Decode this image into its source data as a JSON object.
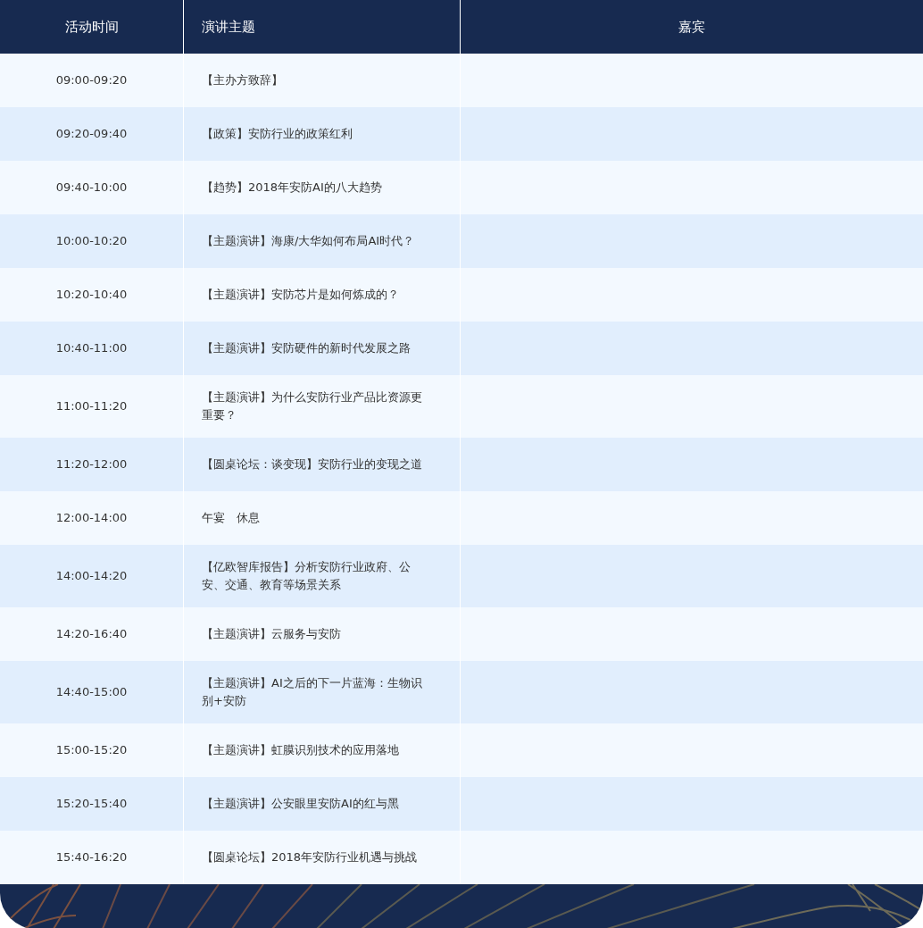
{
  "table": {
    "columns": [
      "活动时间",
      "演讲主题",
      "嘉宾"
    ],
    "rows": [
      {
        "time": "09:00-09:20",
        "topic": "【主办方致辞】"
      },
      {
        "time": "09:20-09:40",
        "topic": "【政策】安防行业的政策红利"
      },
      {
        "time": "09:40-10:00",
        "topic": "【趋势】2018年安防AI的八大趋势"
      },
      {
        "time": "10:00-10:20",
        "topic": "【主题演讲】海康/大华如何布局AI时代？"
      },
      {
        "time": "10:20-10:40",
        "topic": "【主题演讲】安防芯片是如何炼成的？"
      },
      {
        "time": "10:40-11:00",
        "topic": "【主题演讲】安防硬件的新时代发展之路"
      },
      {
        "time": "11:00-11:20",
        "topic": "【主题演讲】为什么安防行业产品比资源更重要？"
      },
      {
        "time": "11:20-12:00",
        "topic": "【圆桌论坛：谈变现】安防行业的变现之道"
      },
      {
        "time": "12:00-14:00",
        "topic": "午宴　休息"
      },
      {
        "time": "14:00-14:20",
        "topic": "【亿欧智库报告】分析安防行业政府、公安、交通、教育等场景关系"
      },
      {
        "time": "14:20-16:40",
        "topic": "【主题演讲】云服务与安防"
      },
      {
        "time": "14:40-15:00",
        "topic": "【主题演讲】AI之后的下一片蓝海：生物识别+安防"
      },
      {
        "time": "15:00-15:20",
        "topic": "【主题演讲】虹膜识别技术的应用落地"
      },
      {
        "time": "15:20-15:40",
        "topic": "【主题演讲】公安眼里安防AI的红与黑"
      },
      {
        "time": "15:40-16:20",
        "topic": "【圆桌论坛】2018年安防行业机遇与挑战"
      }
    ]
  }
}
